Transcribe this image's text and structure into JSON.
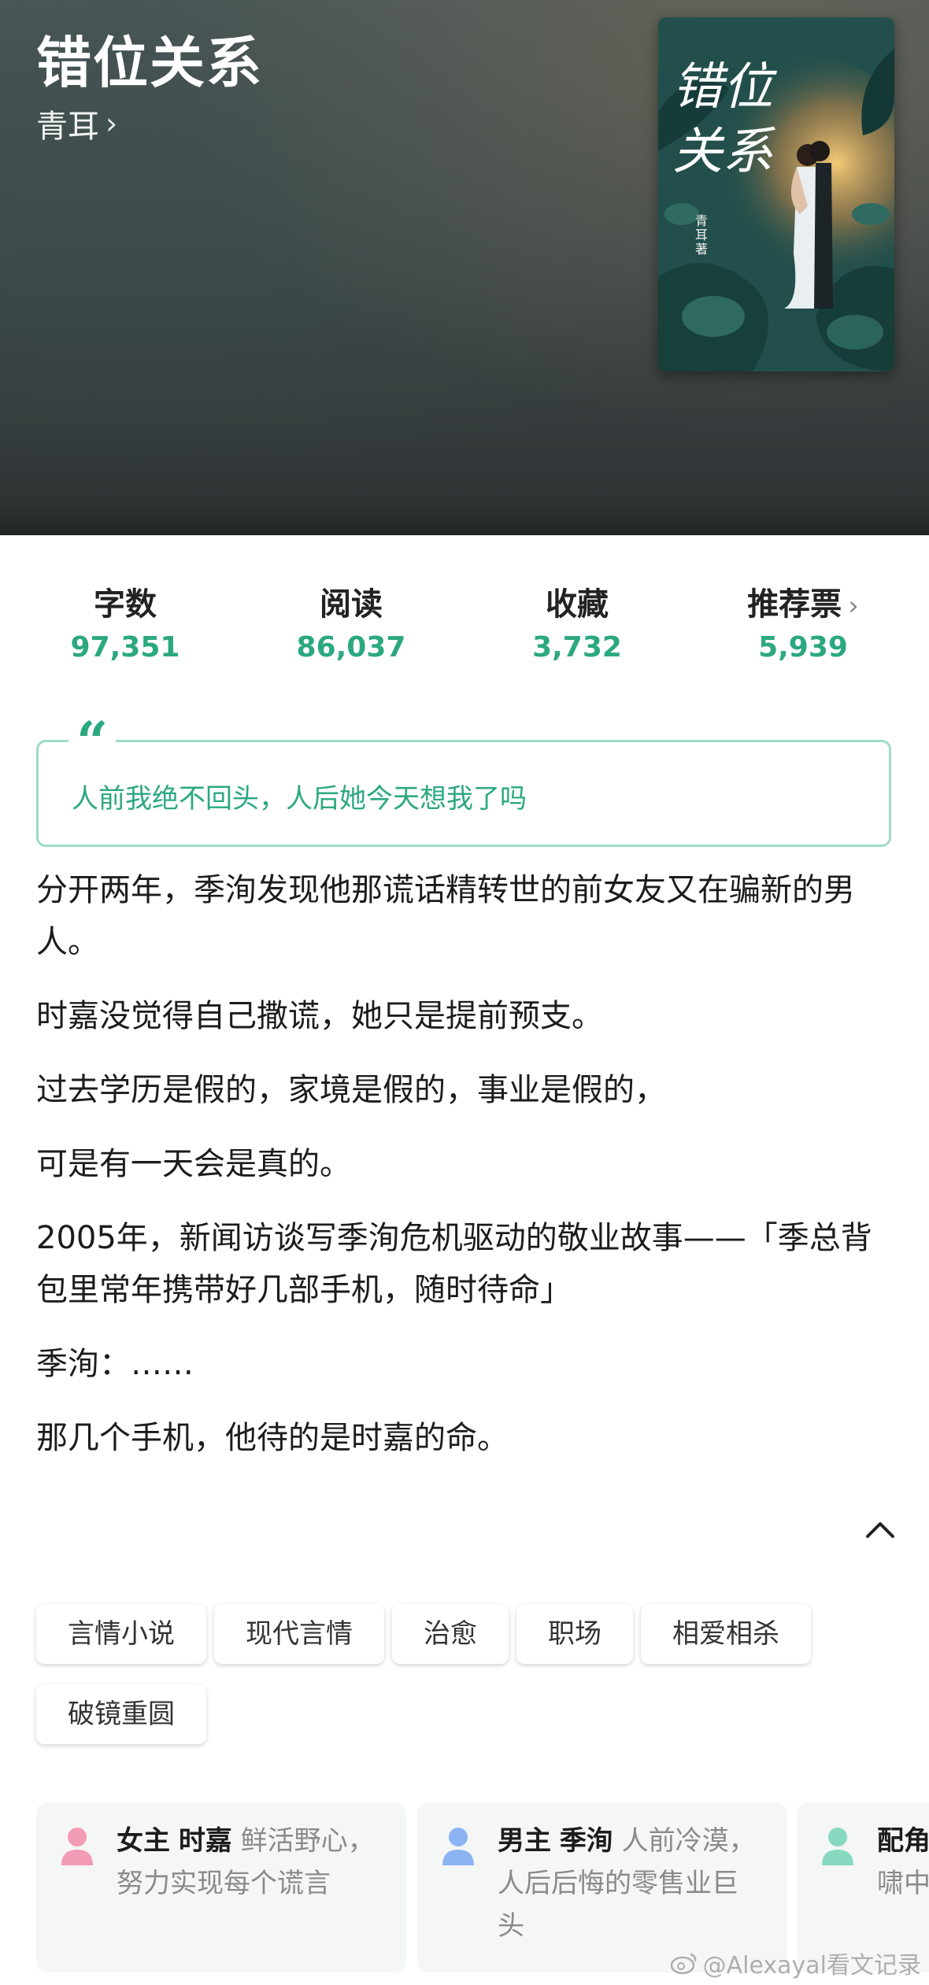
{
  "header": {
    "title": "错位关系",
    "author": "青耳",
    "author_chevron": "›"
  },
  "cover": {
    "title_line1": "错位",
    "title_line2": "关系",
    "author_vertical": "青耳 著"
  },
  "stats": [
    {
      "label": "字数",
      "value": "97,351"
    },
    {
      "label": "阅读",
      "value": "86,037"
    },
    {
      "label": "收藏",
      "value": "3,732"
    },
    {
      "label": "推荐票",
      "value": "5,939",
      "chevron": "›"
    }
  ],
  "quote": {
    "mark": "“",
    "text": "人前我绝不回头，人后她今天想我了吗"
  },
  "synopsis": [
    "分开两年，季洵发现他那谎话精转世的前女友又在骗新的男人。",
    "时嘉没觉得自己撒谎，她只是提前预支。",
    "过去学历是假的，家境是假的，事业是假的，",
    "可是有一天会是真的。",
    "2005年，新闻访谈写季洵危机驱动的敬业故事——「季总背包里常年携带好几部手机，随时待命」",
    "季洵：……",
    "那几个手机，他待的是时嘉的命。"
  ],
  "tags": [
    "言情小说",
    "现代言情",
    "治愈",
    "职场",
    "相爱相杀",
    "破镜重圆"
  ],
  "characters": [
    {
      "role": "女主",
      "name": "时嘉",
      "desc": "鲜活野心，努力实现每个谎言",
      "icon": "female-avatar-icon",
      "color": "#f29bb5"
    },
    {
      "role": "男主",
      "name": "季洵",
      "desc": "人前冷漠，人后后悔的零售业巨头",
      "icon": "male-avatar-icon",
      "color": "#8db4f2"
    },
    {
      "role": "配角",
      "name": "",
      "desc": "啸中",
      "icon": "supporting-avatar-icon",
      "color": "#86d9c0"
    }
  ],
  "watermark": "@Alexayal看文记录",
  "colors": {
    "accent": "#2ca880",
    "quote_border": "#9fdcc3"
  }
}
